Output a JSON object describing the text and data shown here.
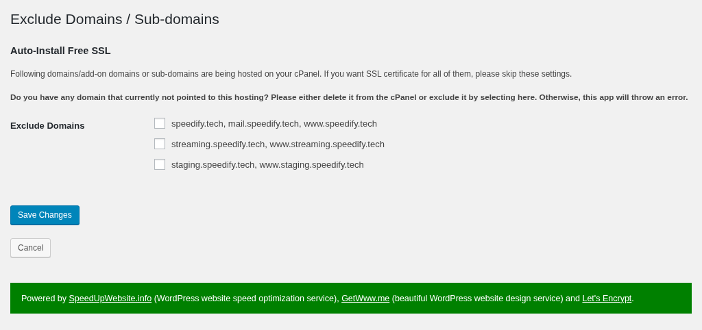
{
  "page_title": "Exclude Domains / Sub-domains",
  "section_title": "Auto-Install Free SSL",
  "intro": "Following domains/add-on domains or sub-domains are being hosted on your cPanel. If you want SSL certificate for all of them, please skip these settings.",
  "warning": "Do you have any domain that currently not pointed to this hosting? Please either delete it from the cPanel or exclude it by selecting here. Otherwise, this app will throw an error.",
  "exclude_domains": {
    "label": "Exclude Domains",
    "options": [
      {
        "label": "speedify.tech, mail.speedify.tech, www.speedify.tech",
        "checked": false
      },
      {
        "label": "streaming.speedify.tech, www.streaming.speedify.tech",
        "checked": false
      },
      {
        "label": "staging.speedify.tech, www.staging.speedify.tech",
        "checked": false
      }
    ]
  },
  "buttons": [
    {
      "label": "Save Changes",
      "kind": "primary"
    },
    {
      "label": "Cancel",
      "kind": "secondary"
    }
  ],
  "footer": {
    "parts": [
      {
        "kind": "text",
        "text": "Powered by "
      },
      {
        "kind": "link",
        "text": "SpeedUpWebsite.info"
      },
      {
        "kind": "text",
        "text": " (WordPress website speed optimization service), "
      },
      {
        "kind": "link",
        "text": "GetWww.me"
      },
      {
        "kind": "text",
        "text": " (beautiful WordPress website design service) and "
      },
      {
        "kind": "link",
        "text": "Let's Encrypt"
      },
      {
        "kind": "text",
        "text": "."
      }
    ]
  }
}
